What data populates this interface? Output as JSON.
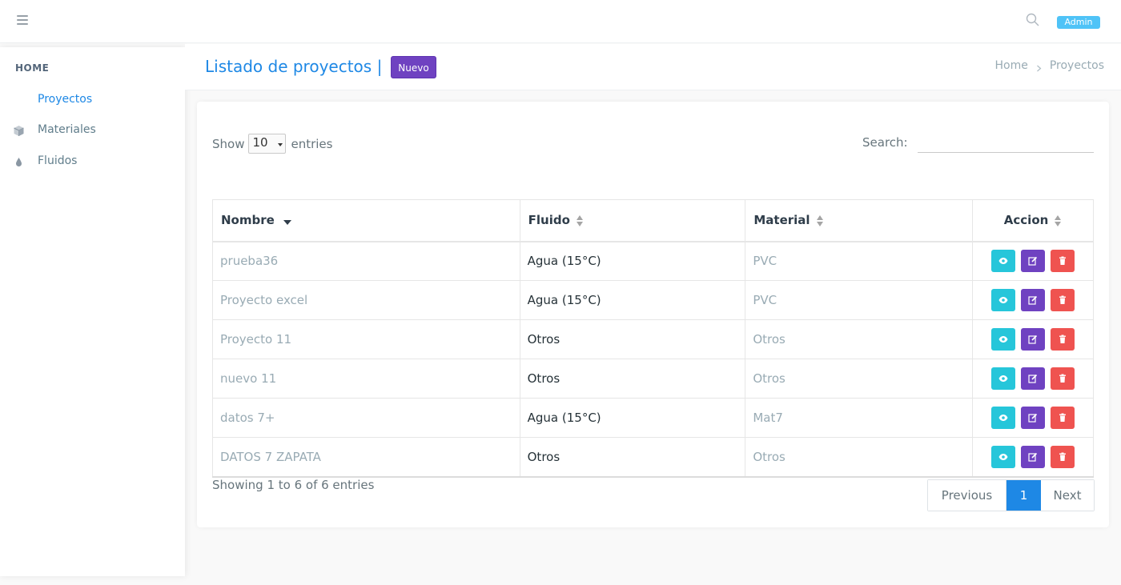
{
  "header": {
    "admin_badge": "Admin"
  },
  "sidebar": {
    "heading": "HOME",
    "items": [
      {
        "label": "Proyectos",
        "icon": "none",
        "active": true
      },
      {
        "label": "Materiales",
        "icon": "cube-icon"
      },
      {
        "label": "Fluidos",
        "icon": "droplet-icon"
      }
    ]
  },
  "titlebar": {
    "title": "Listado de proyectos |",
    "new_button": "Nuevo",
    "breadcrumb": [
      "Home",
      "Proyectos"
    ]
  },
  "table_controls": {
    "show_label": "Show",
    "entries_value": "10",
    "entries_label": "entries",
    "search_label": "Search:",
    "search_value": ""
  },
  "table": {
    "columns": [
      "Nombre",
      "Fluido",
      "Material",
      "Accion"
    ],
    "rows": [
      {
        "nombre": "prueba36",
        "fluido": "Agua (15°C)",
        "material": "PVC"
      },
      {
        "nombre": "Proyecto excel",
        "fluido": "Agua (15°C)",
        "material": "PVC"
      },
      {
        "nombre": "Proyecto 11",
        "fluido": "Otros",
        "material": "Otros"
      },
      {
        "nombre": "nuevo 11",
        "fluido": "Otros",
        "material": "Otros"
      },
      {
        "nombre": "datos 7+",
        "fluido": "Agua (15°C)",
        "material": "Mat7"
      },
      {
        "nombre": "DATOS 7 ZAPATA",
        "fluido": "Otros",
        "material": "Otros"
      }
    ]
  },
  "footer": {
    "showing": "Showing 1 to 6 of 6 entries",
    "previous": "Previous",
    "current_page": "1",
    "next": "Next"
  },
  "colors": {
    "primary": "#1e88e5",
    "purple": "#6f42c1",
    "cyan": "#26c6da",
    "red": "#ef5350",
    "badge": "#4fc3f7"
  }
}
